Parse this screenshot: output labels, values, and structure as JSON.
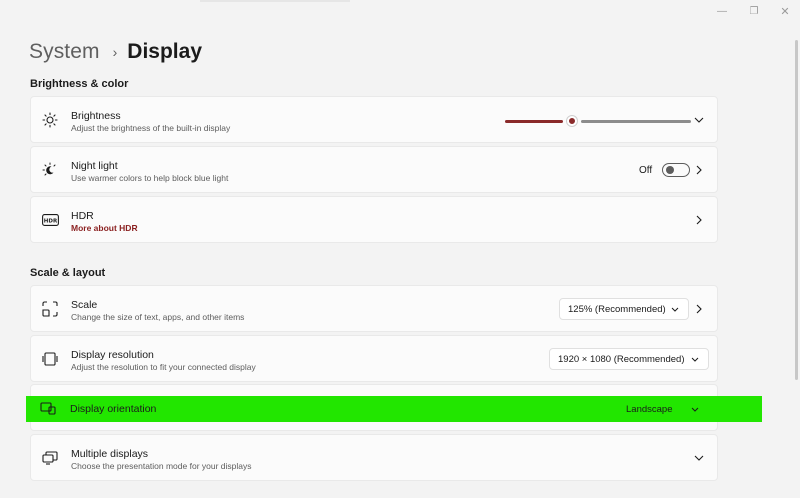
{
  "window": {
    "minimize_glyph": "—",
    "maximize_glyph": "❐",
    "close_glyph": "✕"
  },
  "breadcrumb": {
    "parent": "System",
    "separator": "›",
    "current": "Display"
  },
  "sections": {
    "brightness_color": "Brightness & color",
    "scale_layout": "Scale & layout"
  },
  "brightness": {
    "title": "Brightness",
    "desc": "Adjust the brightness of the built-in display",
    "icon": "sun-icon",
    "level": 0.36
  },
  "night_light": {
    "title": "Night light",
    "desc": "Use warmer colors to help block blue light",
    "state": "Off",
    "icon": "night-light-icon"
  },
  "hdr": {
    "title": "HDR",
    "link": "More about HDR",
    "icon": "hdr-icon"
  },
  "scale": {
    "title": "Scale",
    "desc": "Change the size of text, apps, and other items",
    "value": "125% (Recommended)",
    "icon": "scale-icon"
  },
  "resolution": {
    "title": "Display resolution",
    "desc": "Adjust the resolution to fit your connected display",
    "value": "1920 × 1080 (Recommended)",
    "icon": "resolution-icon"
  },
  "orientation": {
    "title": "Display orientation",
    "value": "Landscape",
    "icon": "orientation-icon"
  },
  "multiple_displays": {
    "title": "Multiple displays",
    "desc": "Choose the presentation mode for your displays",
    "icon": "multiple-displays-icon"
  },
  "colors": {
    "accent": "#8a2a2a",
    "highlight": "#22e600"
  }
}
